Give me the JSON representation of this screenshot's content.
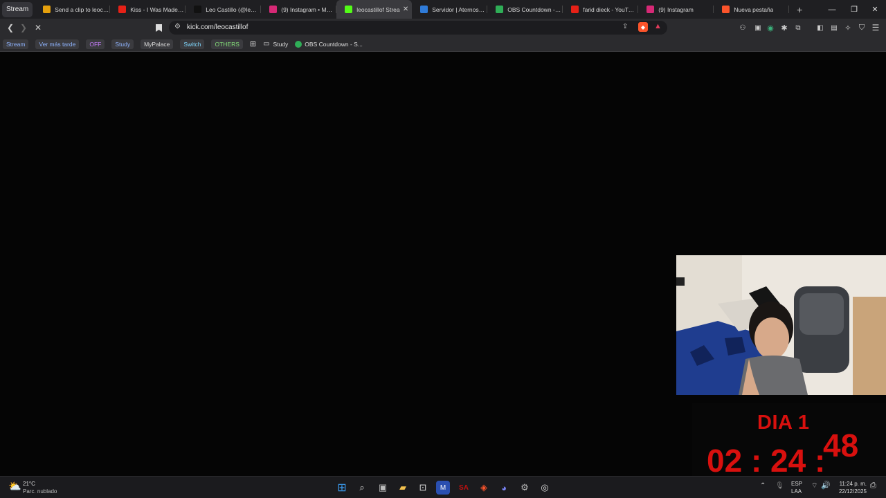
{
  "tab_group": "Stream",
  "tabs": [
    {
      "title": "Send a clip to leocast",
      "icon": "clip-icon",
      "color": "#e5a00d"
    },
    {
      "title": "Kiss - I Was Made For",
      "icon": "youtube-icon",
      "color": "#e62117"
    },
    {
      "title": "Leo Castillo (@leocas",
      "icon": "tiktok-icon",
      "color": "#111111"
    },
    {
      "title": "(9) Instagram • Mens",
      "icon": "instagram-icon",
      "color": "#d62976"
    },
    {
      "title": "leocastillof Strea",
      "icon": "kick-icon",
      "color": "#53fc18",
      "active": true
    },
    {
      "title": "Servidor | Aternos | Se",
      "icon": "aternos-icon",
      "color": "#2f7bd8"
    },
    {
      "title": "OBS Countdown - Str",
      "icon": "obs-icon",
      "color": "#2fae57"
    },
    {
      "title": "farid dieck - YouTube",
      "icon": "youtube-icon",
      "color": "#e62117"
    },
    {
      "title": "(9) Instagram",
      "icon": "instagram-icon",
      "color": "#d62976"
    },
    {
      "title": "Nueva pestaña",
      "icon": "brave-icon",
      "color": "#fb542b"
    }
  ],
  "url": "kick.com/leocastillof",
  "bookmarks": {
    "chips": [
      {
        "label": "Stream",
        "color": "#8fb4ff"
      },
      {
        "label": "Ver más tarde",
        "color": "#8fb4ff"
      },
      {
        "label": "OFF",
        "color": "#c77dff"
      },
      {
        "label": "Study",
        "color": "#8fb4ff"
      },
      {
        "label": "MyPalace",
        "color": "#dddddd"
      },
      {
        "label": "Switch",
        "color": "#7fd8ff"
      },
      {
        "label": "OTHERS",
        "color": "#86e07a"
      }
    ],
    "folder": "Study",
    "link": "OBS Countdown - S..."
  },
  "countdown": {
    "day": "DIA 1",
    "hours_minutes": "02 : 24 :",
    "seconds": "48"
  },
  "weather": {
    "temp": "21°C",
    "desc": "Parc. nublado"
  },
  "tray": {
    "lang": "ESP",
    "layout": "LAA",
    "time": "11:24 p. m.",
    "date": "22/12/2025"
  },
  "colors": {
    "countdown_red": "#d8100e",
    "kick_green": "#53fc18"
  }
}
